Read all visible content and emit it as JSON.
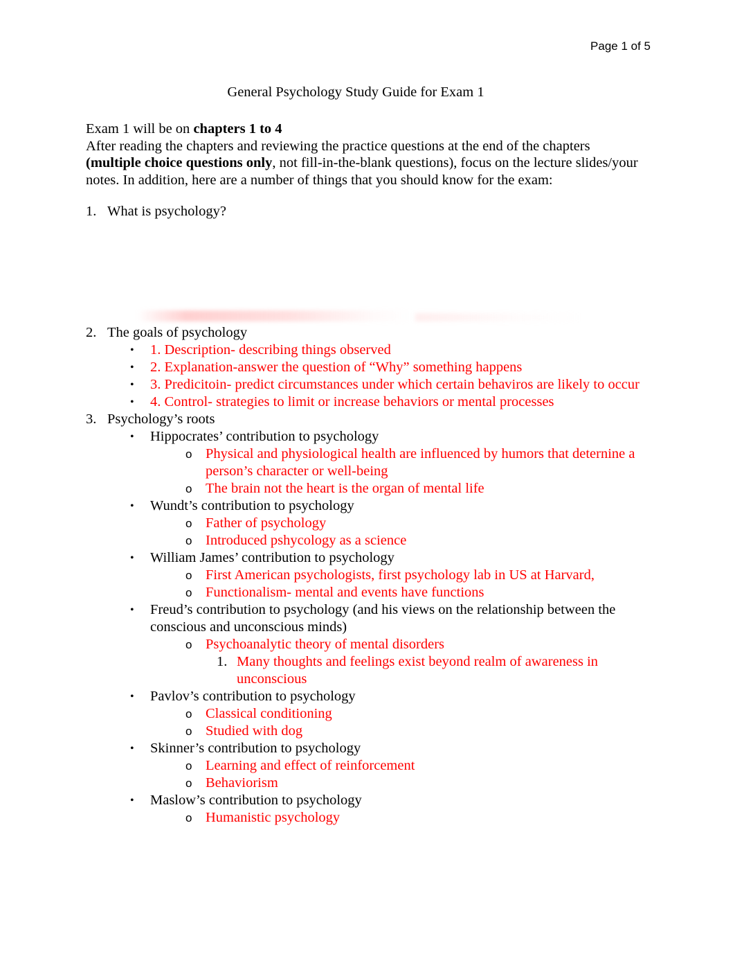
{
  "header": {
    "page_label": "Page 1 of 5"
  },
  "document": {
    "title": "General Psychology Study Guide for Exam 1",
    "intro": {
      "line1_pre": "Exam 1 will be on ",
      "line1_bold": "chapters 1 to 4",
      "line2": "After reading the chapters and reviewing the practice questions at the end of the chapters",
      "line3_bold": "(multiple choice questions only",
      "line3_rest": ", not fill-in-the-blank questions), focus on the lecture slides/your",
      "line4": "notes. In addition, here are a number of things that you should know for the exam:"
    },
    "items": [
      {
        "number": "1.",
        "text": "What is psychology?"
      },
      {
        "number": "2.",
        "text": "The goals of psychology",
        "bullets": [
          {
            "marker": "•",
            "text": "1. Description- describing things observed",
            "color": "red"
          },
          {
            "marker": "•",
            "text": "2. Explanation-answer the question of “Why” something happens",
            "color": "red"
          },
          {
            "marker": "•",
            "text": "3. Predicitoin- predict circumstances under which certain behaviros are likely to occur",
            "color": "red"
          },
          {
            "marker": "•",
            "text": "4. Control- strategies to limit or increase behaviors or mental processes",
            "color": "red"
          }
        ]
      },
      {
        "number": "3.",
        "text": "Psychology’s roots",
        "bullets": [
          {
            "marker": "•",
            "text": "Hippocrates’ contribution to psychology",
            "color": "black",
            "subs": [
              {
                "marker": "o",
                "text": "Physical and physiological health are influenced by humors that deternine a person’s character or well-being",
                "color": "red"
              },
              {
                "marker": "o",
                "text": "The brain not the heart is the organ of mental life",
                "color": "red"
              }
            ]
          },
          {
            "marker": "•",
            "text": "Wundt’s contribution to psychology",
            "color": "black",
            "subs": [
              {
                "marker": "o",
                "text": "Father of psychology",
                "color": "red"
              },
              {
                "marker": "o",
                "text": "Introduced pshycology as a science",
                "color": "red"
              }
            ]
          },
          {
            "marker": "•",
            "text": "William James’ contribution to psychology",
            "color": "black",
            "subs": [
              {
                "marker": "o",
                "text": "First American psychologists, first psychology lab in US at Harvard,",
                "color": "red"
              },
              {
                "marker": "o",
                "text": "Functionalism- mental and events have functions",
                "color": "red"
              }
            ]
          },
          {
            "marker": "•",
            "text": "Freud’s contribution to psychology (and his views on the relationship between the conscious and unconscious minds)",
            "color": "black",
            "subs": [
              {
                "marker": "o",
                "text": "Psychoanalytic theory of mental disorders",
                "color": "red",
                "subsubs": [
                  {
                    "marker": "1.",
                    "text": "Many thoughts and feelings exist beyond realm of awareness in unconscious",
                    "color": "red"
                  }
                ]
              }
            ]
          },
          {
            "marker": "•",
            "text": "Pavlov’s contribution to psychology",
            "color": "black",
            "subs": [
              {
                "marker": "o",
                "text": "Classical conditioning",
                "color": "red"
              },
              {
                "marker": "o",
                "text": "Studied with dog",
                "color": "red"
              }
            ]
          },
          {
            "marker": "•",
            "text": "Skinner’s contribution to psychology",
            "color": "black",
            "subs": [
              {
                "marker": "o",
                "text": "Learning and effect of reinforcement",
                "color": "red"
              },
              {
                "marker": "o",
                "text": "Behaviorism",
                "color": "red"
              }
            ]
          },
          {
            "marker": "•",
            "text": "Maslow’s contribution to psychology",
            "color": "black",
            "subs": [
              {
                "marker": "o",
                "text": "Humanistic psychology",
                "color": "red"
              }
            ]
          }
        ]
      }
    ]
  },
  "colors": {
    "annotation_red": "#ff0000",
    "body_black": "#000000",
    "page_background": "#ffffff"
  }
}
